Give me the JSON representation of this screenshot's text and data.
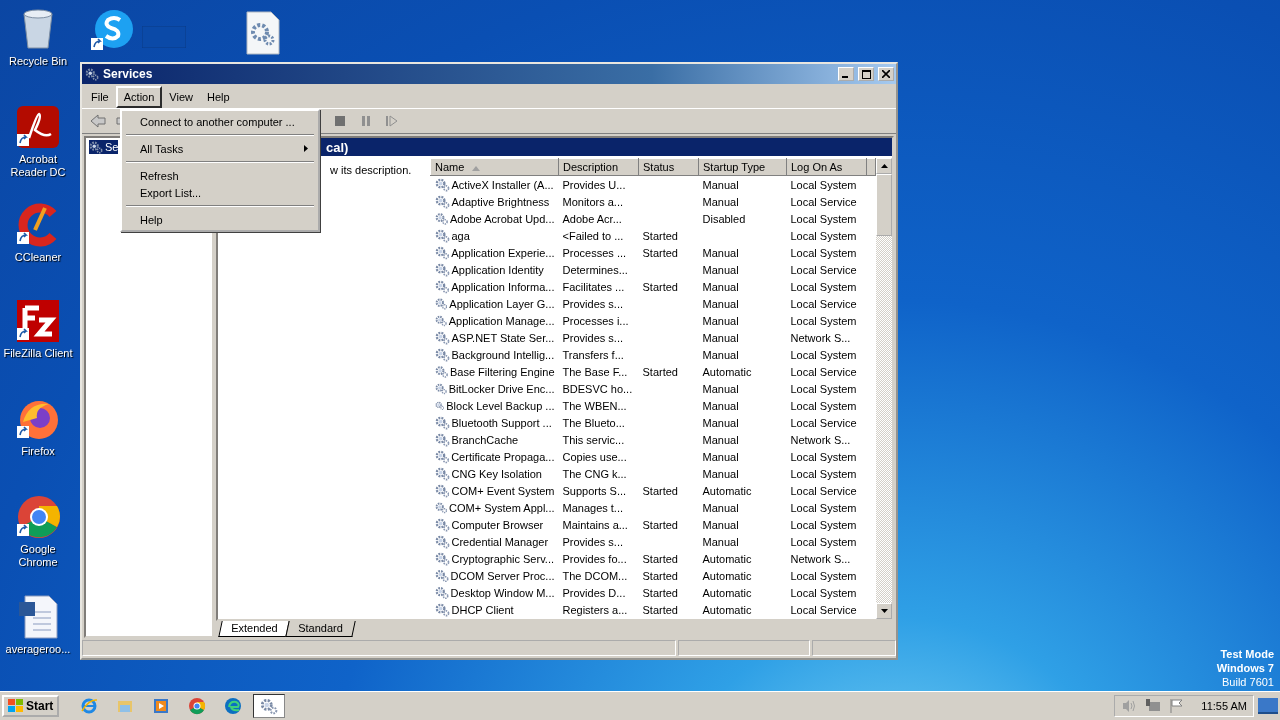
{
  "desktop": {
    "icons": [
      {
        "kind": "recycle",
        "label": "Recycle Bin"
      },
      {
        "kind": "skype"
      },
      {
        "kind": "panel"
      },
      {
        "kind": "gearfile"
      },
      {
        "kind": "acrobat",
        "label": "Acrobat Reader DC"
      },
      {
        "kind": "ccleaner",
        "label": "CCleaner"
      },
      {
        "kind": "filezilla",
        "label": "FileZilla Client"
      },
      {
        "kind": "firefox",
        "label": "Firefox"
      },
      {
        "kind": "chrome",
        "label": "Google Chrome"
      },
      {
        "kind": "word",
        "label": "averageroo..."
      }
    ],
    "notice": [
      "Test Mode",
      "Windows 7",
      "Build 7601"
    ]
  },
  "window": {
    "title": "Services",
    "menu": [
      {
        "label": "File",
        "selected": false
      },
      {
        "label": "Action",
        "selected": true
      },
      {
        "label": "View",
        "selected": false
      },
      {
        "label": "Help",
        "selected": false
      }
    ],
    "action_menu": [
      {
        "kind": "item",
        "label": "Connect to another computer ..."
      },
      {
        "kind": "separator"
      },
      {
        "kind": "submenu",
        "label": "All Tasks"
      },
      {
        "kind": "separator"
      },
      {
        "kind": "item",
        "label": "Refresh"
      },
      {
        "kind": "item",
        "label": "Export List..."
      },
      {
        "kind": "separator"
      },
      {
        "kind": "item",
        "label": "Help"
      }
    ],
    "tree": [
      {
        "label": "Se",
        "selected": true
      }
    ],
    "header": "cal)",
    "description_hint": "w its description.",
    "table": {
      "columns": [
        {
          "label": "Name",
          "sorted": true
        },
        {
          "label": "Description",
          "sorted": false
        },
        {
          "label": "Status",
          "sorted": false
        },
        {
          "label": "Startup Type",
          "sorted": false
        },
        {
          "label": "Log On As",
          "sorted": false
        }
      ],
      "rows": [
        {
          "name": "ActiveX Installer (A...",
          "description": "Provides U...",
          "startup_type": "Manual",
          "log_on_as": "Local System"
        },
        {
          "name": "Adaptive Brightness",
          "description": "Monitors a...",
          "startup_type": "Manual",
          "log_on_as": "Local Service"
        },
        {
          "name": "Adobe Acrobat Upd...",
          "description": "Adobe Acr...",
          "startup_type": "Disabled",
          "log_on_as": "Local System"
        },
        {
          "name": "aga",
          "description": "<Failed to ...",
          "status": "Started",
          "log_on_as": "Local System"
        },
        {
          "name": "Application Experie...",
          "description": "Processes ...",
          "status": "Started",
          "startup_type": "Manual",
          "log_on_as": "Local System"
        },
        {
          "name": "Application Identity",
          "description": "Determines...",
          "startup_type": "Manual",
          "log_on_as": "Local Service"
        },
        {
          "name": "Application Informa...",
          "description": "Facilitates ...",
          "status": "Started",
          "startup_type": "Manual",
          "log_on_as": "Local System"
        },
        {
          "name": "Application Layer G...",
          "description": "Provides s...",
          "startup_type": "Manual",
          "log_on_as": "Local Service"
        },
        {
          "name": "Application Manage...",
          "description": "Processes i...",
          "startup_type": "Manual",
          "log_on_as": "Local System"
        },
        {
          "name": "ASP.NET State Ser...",
          "description": "Provides s...",
          "startup_type": "Manual",
          "log_on_as": "Network S..."
        },
        {
          "name": "Background Intellig...",
          "description": "Transfers f...",
          "startup_type": "Manual",
          "log_on_as": "Local System"
        },
        {
          "name": "Base Filtering Engine",
          "description": "The Base F...",
          "status": "Started",
          "startup_type": "Automatic",
          "log_on_as": "Local Service"
        },
        {
          "name": "BitLocker Drive Enc...",
          "description": "BDESVC ho...",
          "startup_type": "Manual",
          "log_on_as": "Local System"
        },
        {
          "name": "Block Level Backup ...",
          "description": "The WBEN...",
          "startup_type": "Manual",
          "log_on_as": "Local System"
        },
        {
          "name": "Bluetooth Support ...",
          "description": "The Blueto...",
          "startup_type": "Manual",
          "log_on_as": "Local Service"
        },
        {
          "name": "BranchCache",
          "description": "This servic...",
          "startup_type": "Manual",
          "log_on_as": "Network S..."
        },
        {
          "name": "Certificate Propaga...",
          "description": "Copies use...",
          "startup_type": "Manual",
          "log_on_as": "Local System"
        },
        {
          "name": "CNG Key Isolation",
          "description": "The CNG k...",
          "startup_type": "Manual",
          "log_on_as": "Local System"
        },
        {
          "name": "COM+ Event System",
          "description": "Supports S...",
          "status": "Started",
          "startup_type": "Automatic",
          "log_on_as": "Local Service"
        },
        {
          "name": "COM+ System Appl...",
          "description": "Manages t...",
          "startup_type": "Manual",
          "log_on_as": "Local System"
        },
        {
          "name": "Computer Browser",
          "description": "Maintains a...",
          "status": "Started",
          "startup_type": "Manual",
          "log_on_as": "Local System"
        },
        {
          "name": "Credential Manager",
          "description": "Provides s...",
          "startup_type": "Manual",
          "log_on_as": "Local System"
        },
        {
          "name": "Cryptographic Serv...",
          "description": "Provides fo...",
          "status": "Started",
          "startup_type": "Automatic",
          "log_on_as": "Network S..."
        },
        {
          "name": "DCOM Server Proc...",
          "description": "The DCOM...",
          "status": "Started",
          "startup_type": "Automatic",
          "log_on_as": "Local System"
        },
        {
          "name": "Desktop Window M...",
          "description": "Provides D...",
          "status": "Started",
          "startup_type": "Automatic",
          "log_on_as": "Local System"
        },
        {
          "name": "DHCP Client",
          "description": "Registers a...",
          "status": "Started",
          "startup_type": "Automatic",
          "log_on_as": "Local Service"
        }
      ]
    },
    "tabs": [
      {
        "label": "Extended",
        "selected": true
      },
      {
        "label": "Standard",
        "selected": false
      }
    ]
  },
  "taskbar": {
    "start": "Start",
    "apps": [
      {
        "kind": "ie",
        "selected": false
      },
      {
        "kind": "explorer",
        "selected": false
      },
      {
        "kind": "media",
        "selected": false
      },
      {
        "kind": "chrome",
        "selected": false
      },
      {
        "kind": "edge",
        "selected": false
      },
      {
        "kind": "services",
        "selected": true
      }
    ],
    "clock": "11:55 AM"
  }
}
